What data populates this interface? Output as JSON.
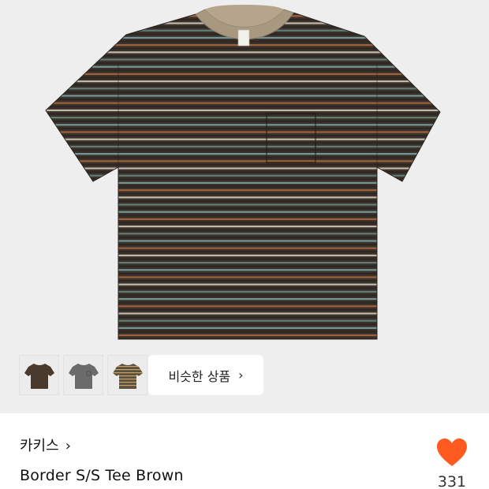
{
  "product_image": {
    "background_color": "#eeeeee",
    "collar_color": "#a89880",
    "body_base_color": "#3a322c"
  },
  "thumbnails": [
    {
      "name": "brown-tee-thumbnail",
      "color": "#4a3a2e"
    },
    {
      "name": "grey-tee-thumbnail",
      "color": "#6b6b6b"
    },
    {
      "name": "striped-tee-thumbnail",
      "color": "#5a5040"
    }
  ],
  "similar_products": {
    "label": "비슷한 상품",
    "chevron": "›"
  },
  "product": {
    "brand": "카키스",
    "brand_chevron": "›",
    "title": "Border S/S Tee Brown"
  },
  "like": {
    "icon": "heart-icon",
    "color": "#ff5a1f",
    "count": "331"
  }
}
